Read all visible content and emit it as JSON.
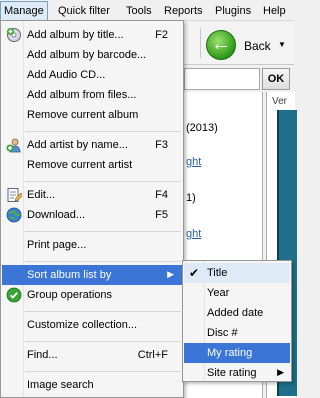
{
  "menubar": {
    "items": [
      "Manage",
      "Quick filter",
      "Tools",
      "Reports",
      "Plugins",
      "Help"
    ]
  },
  "toolbar": {
    "back_label": "Back",
    "ok_label": "OK"
  },
  "background": {
    "year_text": "(2013)",
    "link1": "ght",
    "paren_text": "1)",
    "link2": "ght",
    "panel_header": "Ver"
  },
  "manage_menu": {
    "items": [
      {
        "label": "Add album by title...",
        "shortcut": "F2",
        "icon": "add-album-icon"
      },
      {
        "label": "Add album by barcode...",
        "shortcut": ""
      },
      {
        "label": "Add Audio CD...",
        "shortcut": ""
      },
      {
        "label": "Add album from files...",
        "shortcut": ""
      },
      {
        "label": "Remove current album",
        "shortcut": ""
      },
      {
        "label": "Add artist by name...",
        "shortcut": "F3",
        "icon": "add-artist-icon"
      },
      {
        "label": "Remove current artist",
        "shortcut": ""
      },
      {
        "label": "Edit...",
        "shortcut": "F4",
        "icon": "edit-icon"
      },
      {
        "label": "Download...",
        "shortcut": "F5",
        "icon": "download-globe-icon"
      },
      {
        "label": "Print page...",
        "shortcut": ""
      },
      {
        "label": "Sort album list by",
        "shortcut": ""
      },
      {
        "label": "Group operations",
        "shortcut": "",
        "icon": "group-check-icon"
      },
      {
        "label": "Customize collection...",
        "shortcut": ""
      },
      {
        "label": "Find...",
        "shortcut": "Ctrl+F"
      },
      {
        "label": "Image search",
        "shortcut": ""
      }
    ]
  },
  "sort_submenu": {
    "items": [
      "Title",
      "Year",
      "Added date",
      "Disc #",
      "My rating",
      "Site rating"
    ],
    "checked": "Title",
    "highlighted": "My rating"
  },
  "colors": {
    "selection": "#3b75d6",
    "link": "#2a5db0",
    "menu_bg": "#f5f5f5"
  }
}
